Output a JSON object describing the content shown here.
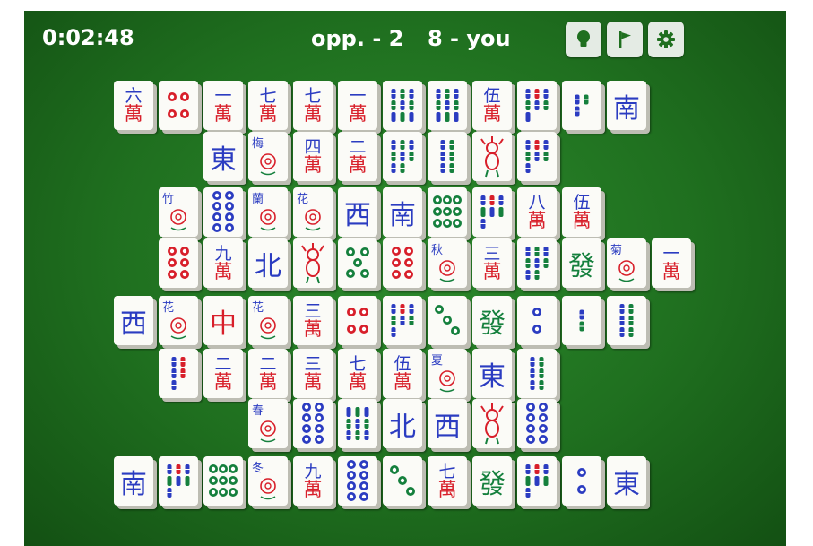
{
  "hud": {
    "timer": "0:02:48",
    "opponent_score": "opp. - 2",
    "player_score": "8 - you"
  },
  "toolbar": [
    "hint-icon",
    "flag-icon",
    "gear-icon"
  ],
  "colors": {
    "felt": "#1f6f1f",
    "tile_face": "#fbfbf7",
    "tile_edge": "#bdbdb3",
    "red": "#d81f2a",
    "blue": "#2b3cc1",
    "green": "#15803d"
  },
  "tiles": [
    {
      "kind": "char",
      "num": "六"
    },
    {
      "kind": "dots",
      "n": 4
    },
    {
      "kind": "char",
      "num": "一"
    },
    {
      "kind": "char",
      "num": "七"
    },
    {
      "kind": "char",
      "num": "七"
    },
    {
      "kind": "char",
      "num": "一"
    },
    {
      "kind": "bam",
      "n": 9
    },
    {
      "kind": "bam",
      "n": 9
    },
    {
      "kind": "char",
      "num": "伍"
    },
    {
      "kind": "bam",
      "n": 7
    },
    {
      "kind": "bam",
      "n": 3
    },
    {
      "kind": "wind",
      "text": "南"
    },
    {
      "kind": "wind",
      "text": "東"
    },
    {
      "kind": "flower",
      "label": "梅"
    },
    {
      "kind": "char",
      "num": "四"
    },
    {
      "kind": "char",
      "num": "二"
    },
    {
      "kind": "bam",
      "n": 8
    },
    {
      "kind": "bam",
      "n": 6
    },
    {
      "kind": "bird"
    },
    {
      "kind": "bam",
      "n": 7
    },
    {
      "kind": "flower",
      "label": "竹"
    },
    {
      "kind": "dots",
      "n": 8
    },
    {
      "kind": "flower",
      "label": "蘭"
    },
    {
      "kind": "flower",
      "label": "花"
    },
    {
      "kind": "wind",
      "text": "西"
    },
    {
      "kind": "wind",
      "text": "南"
    },
    {
      "kind": "dots",
      "n": 9
    },
    {
      "kind": "bam",
      "n": 7
    },
    {
      "kind": "char",
      "num": "八"
    },
    {
      "kind": "char",
      "num": "伍"
    },
    {
      "kind": "dots",
      "n": 6
    },
    {
      "kind": "char",
      "num": "九"
    },
    {
      "kind": "wind",
      "text": "北"
    },
    {
      "kind": "bird"
    },
    {
      "kind": "dots",
      "n": 5
    },
    {
      "kind": "dots",
      "n": 6
    },
    {
      "kind": "flower",
      "label": "秋"
    },
    {
      "kind": "char",
      "num": "三"
    },
    {
      "kind": "bam",
      "n": 8
    },
    {
      "kind": "dragon",
      "text": "發"
    },
    {
      "kind": "flower",
      "label": "菊"
    },
    {
      "kind": "char",
      "num": "一"
    },
    {
      "kind": "wind",
      "text": "西"
    },
    {
      "kind": "flower",
      "label": "花"
    },
    {
      "kind": "dragon",
      "text": "中"
    },
    {
      "kind": "flower",
      "label": "花"
    },
    {
      "kind": "char",
      "num": "三"
    },
    {
      "kind": "dots",
      "n": 4
    },
    {
      "kind": "bam",
      "n": 7
    },
    {
      "kind": "dots",
      "n": 3
    },
    {
      "kind": "dragon",
      "text": "發"
    },
    {
      "kind": "dots",
      "n": 2
    },
    {
      "kind": "bam",
      "n": 2
    },
    {
      "kind": "bam",
      "n": 6
    },
    {
      "kind": "bam",
      "n": 5
    },
    {
      "kind": "char",
      "num": "二"
    },
    {
      "kind": "char",
      "num": "二"
    },
    {
      "kind": "char",
      "num": "三"
    },
    {
      "kind": "char",
      "num": "七"
    },
    {
      "kind": "char",
      "num": "伍"
    },
    {
      "kind": "flower",
      "label": "夏"
    },
    {
      "kind": "wind",
      "text": "東"
    },
    {
      "kind": "bam",
      "n": 6
    },
    {
      "kind": "flower",
      "label": "春"
    },
    {
      "kind": "dots",
      "n": 8
    },
    {
      "kind": "bam",
      "n": 9
    },
    {
      "kind": "wind",
      "text": "北"
    },
    {
      "kind": "wind",
      "text": "西"
    },
    {
      "kind": "bird"
    },
    {
      "kind": "dots",
      "n": 8
    },
    {
      "kind": "wind",
      "text": "南"
    },
    {
      "kind": "bam",
      "n": 7
    },
    {
      "kind": "dots",
      "n": 9
    },
    {
      "kind": "flower",
      "label": "冬"
    },
    {
      "kind": "char",
      "num": "九"
    },
    {
      "kind": "dots",
      "n": 8
    },
    {
      "kind": "dots",
      "n": 3
    },
    {
      "kind": "char",
      "num": "七"
    },
    {
      "kind": "dragon",
      "text": "發"
    },
    {
      "kind": "bam",
      "n": 7
    },
    {
      "kind": "dots",
      "n": 2
    },
    {
      "kind": "wind",
      "text": "東"
    }
  ]
}
